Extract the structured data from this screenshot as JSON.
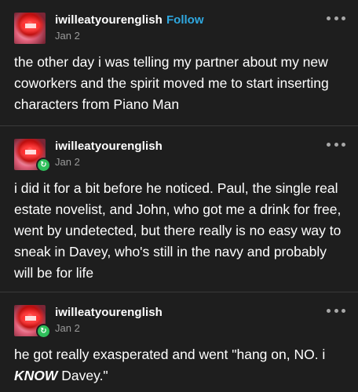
{
  "posts": [
    {
      "username": "iwilleatyourenglish",
      "follow_label": "Follow",
      "date": "Jan 2",
      "text": "the other day i was telling my partner about my new coworkers and the spirit moved me to start inserting characters from Piano Man",
      "reblog": false
    },
    {
      "username": "iwilleatyourenglish",
      "date": "Jan 2",
      "text": "i did it for a bit before he noticed. Paul, the single real estate novelist, and John, who got me a drink for free, went by undetected, but there really is no easy way to sneak in Davey, who's still in the navy and probably will be for life",
      "reblog": true
    },
    {
      "username": "iwilleatyourenglish",
      "date": "Jan 2",
      "text_before": "he got really exasperated and went \"hang on, NO. i ",
      "text_emphasis": "KNOW",
      "text_after": " Davey.\"",
      "reblog": true
    }
  ],
  "icons": {
    "more": "more-options-icon",
    "reblog": "reblog-icon"
  },
  "colors": {
    "background": "#1e1e1e",
    "follow": "#2fa8e0",
    "reblog_badge": "#2fbf5b",
    "date": "#9a9a9a"
  }
}
